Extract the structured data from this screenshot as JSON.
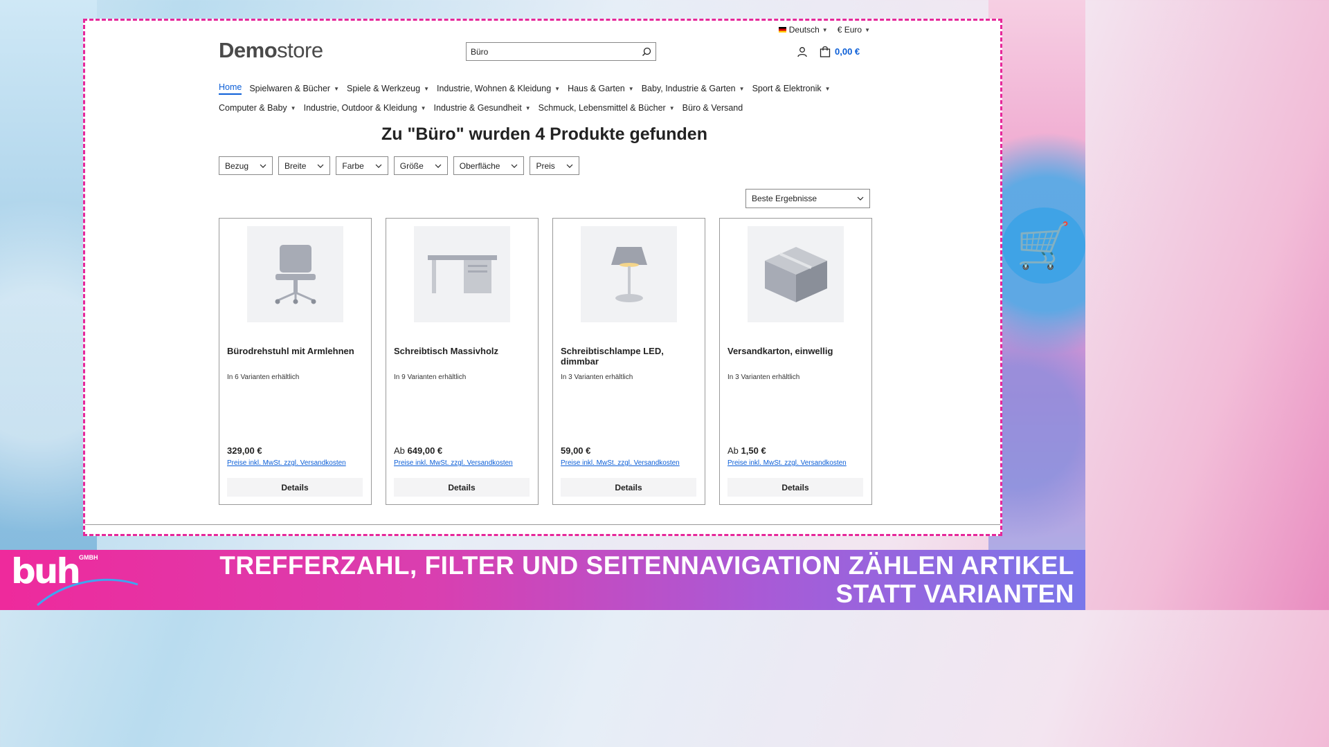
{
  "topbar": {
    "language": "Deutsch",
    "currency": "€ Euro"
  },
  "logo": {
    "bold": "Demo",
    "light": "store"
  },
  "search": {
    "value": "Büro"
  },
  "cart": {
    "total": "0,00 €"
  },
  "nav": {
    "row1": [
      {
        "label": "Home",
        "active": true,
        "dropdown": false
      },
      {
        "label": "Spielwaren & Bücher",
        "dropdown": true
      },
      {
        "label": "Spiele & Werkzeug",
        "dropdown": true
      },
      {
        "label": "Industrie, Wohnen & Kleidung",
        "dropdown": true
      },
      {
        "label": "Haus & Garten",
        "dropdown": true
      },
      {
        "label": "Baby, Industrie & Garten",
        "dropdown": true
      },
      {
        "label": "Sport & Elektronik",
        "dropdown": true
      }
    ],
    "row2": [
      {
        "label": "Computer & Baby",
        "dropdown": true
      },
      {
        "label": "Industrie, Outdoor & Kleidung",
        "dropdown": true
      },
      {
        "label": "Industrie & Gesundheit",
        "dropdown": true
      },
      {
        "label": "Schmuck, Lebensmittel & Bücher",
        "dropdown": true
      },
      {
        "label": "Büro & Versand",
        "dropdown": false
      }
    ]
  },
  "headline": "Zu \"Büro\" wurden 4 Produkte gefunden",
  "filters": [
    "Bezug",
    "Breite",
    "Farbe",
    "Größe",
    "Oberfläche",
    "Preis"
  ],
  "sort": {
    "selected": "Beste Ergebnisse"
  },
  "products": [
    {
      "icon": "office-chair-icon",
      "name": "Bürodrehstuhl mit Armlehnen",
      "variants": "In 6 Varianten erhältlich",
      "price_prefix": "",
      "price": "329,00 €",
      "tax": "Preise inkl. MwSt. zzgl. Versandkosten",
      "button": "Details"
    },
    {
      "icon": "desk-icon",
      "name": "Schreibtisch Massivholz",
      "variants": "In 9 Varianten erhältlich",
      "price_prefix": "Ab",
      "price": "649,00 €",
      "tax": "Preise inkl. MwSt. zzgl. Versandkosten",
      "button": "Details"
    },
    {
      "icon": "desk-lamp-icon",
      "name": "Schreibtischlampe LED, dimmbar",
      "variants": "In 3 Varianten erhältlich",
      "price_prefix": "",
      "price": "59,00 €",
      "tax": "Preise inkl. MwSt. zzgl. Versandkosten",
      "button": "Details"
    },
    {
      "icon": "box-icon",
      "name": "Versandkarton, einwellig",
      "variants": "In 3 Varianten erhältlich",
      "price_prefix": "Ab",
      "price": "1,50 €",
      "tax": "Preise inkl. MwSt. zzgl. Versandkosten",
      "button": "Details"
    }
  ],
  "banner": {
    "brand": "buh",
    "brand_suffix": "GMBH",
    "title_line1": "TREFFERZAHL, FILTER UND SEITENNAVIGATION ZÄHLEN ARTIKEL",
    "title_line2": "STATT VARIANTEN"
  },
  "colors": {
    "accent": "#0b5ed7",
    "frame_dash": "#e6279a",
    "banner_start": "#ee2a9c",
    "banner_end": "#7a77ea"
  }
}
